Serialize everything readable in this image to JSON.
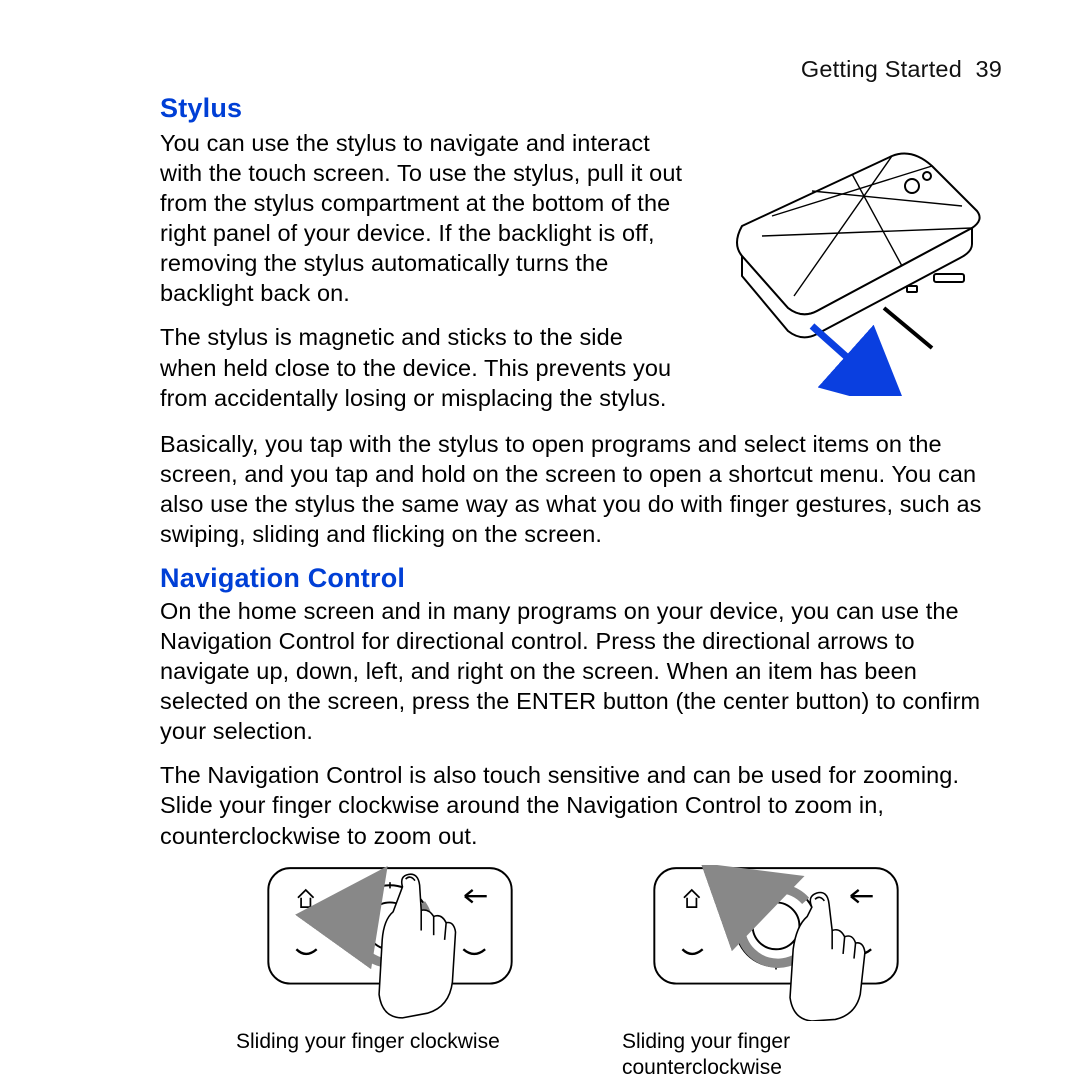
{
  "header": {
    "section": "Getting Started",
    "page": "39"
  },
  "stylus": {
    "title": "Stylus",
    "p1": "You can use the stylus to navigate and interact with the touch screen. To use the stylus, pull it out from the stylus compartment at the bottom of the right panel of your device. If the backlight is off, removing the stylus automatically turns the backlight back on.",
    "p2": "The stylus is magnetic and sticks to the side when held close to the device. This prevents you from accidentally losing or misplacing the stylus.",
    "p3": "Basically, you tap with the stylus to open programs and select items on the screen, and you tap and hold on the screen to open a shortcut menu. You can also use the stylus the same way as what you do with finger gestures, such as swiping, sliding and flicking on the screen."
  },
  "nav": {
    "title": "Navigation Control",
    "p1": "On the home screen and in many programs on your device, you can use the Navigation Control for directional control. Press the directional arrows to navigate up, down, left, and right on the screen. When an item has been selected on the screen, press the ENTER button (the center button) to confirm your selection.",
    "p2": "The Navigation Control is also touch sensitive and can be used for zooming. Slide your finger clockwise around the Navigation Control to zoom in, counterclockwise to zoom out.",
    "cap_cw": "Sliding your finger clockwise",
    "cap_ccw": "Sliding your finger counterclockwise"
  }
}
